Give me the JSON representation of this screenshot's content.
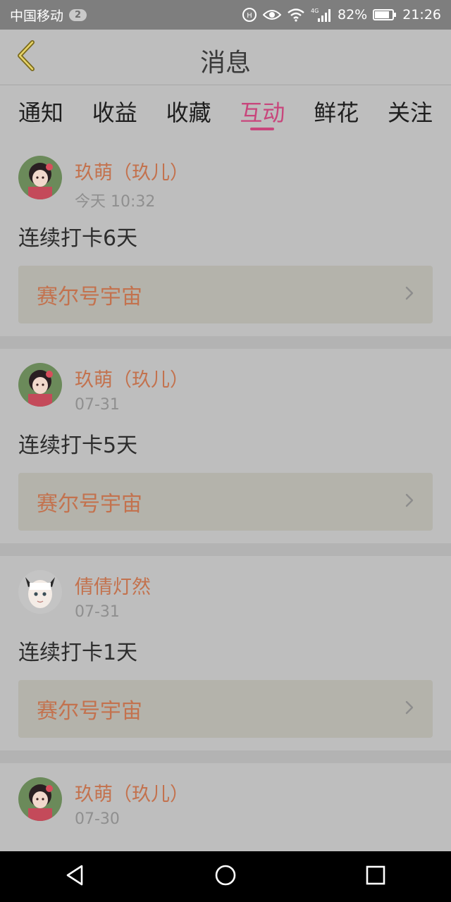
{
  "status_bar": {
    "carrier": "中国移动",
    "sim_badge": "2",
    "network": "4G",
    "battery": "82%",
    "time": "21:26"
  },
  "header": {
    "title": "消息",
    "back_icon": "chevron-left-icon"
  },
  "tabs": [
    {
      "label": "通知",
      "active": false
    },
    {
      "label": "收益",
      "active": false
    },
    {
      "label": "收藏",
      "active": false
    },
    {
      "label": "互动",
      "active": true
    },
    {
      "label": "鲜花",
      "active": false
    },
    {
      "label": "关注",
      "active": false
    }
  ],
  "colors": {
    "accent": "#c8467c",
    "username": "#c3724e",
    "background": "#bebebe"
  },
  "cards": [
    {
      "username": "玖萌（玖儿）",
      "time": "今天 10:32",
      "message": "连续打卡6天",
      "link": "赛尔号宇宙"
    },
    {
      "username": "玖萌（玖儿）",
      "time": "07-31",
      "message": "连续打卡5天",
      "link": "赛尔号宇宙"
    },
    {
      "username": "倩倩灯然",
      "time": "07-31",
      "message": "连续打卡1天",
      "link": "赛尔号宇宙"
    },
    {
      "username": "玖萌（玖儿）",
      "time": "07-30",
      "message": "",
      "link": ""
    }
  ],
  "nav_bar": [
    "back-triangle-icon",
    "home-circle-icon",
    "recents-square-icon"
  ]
}
